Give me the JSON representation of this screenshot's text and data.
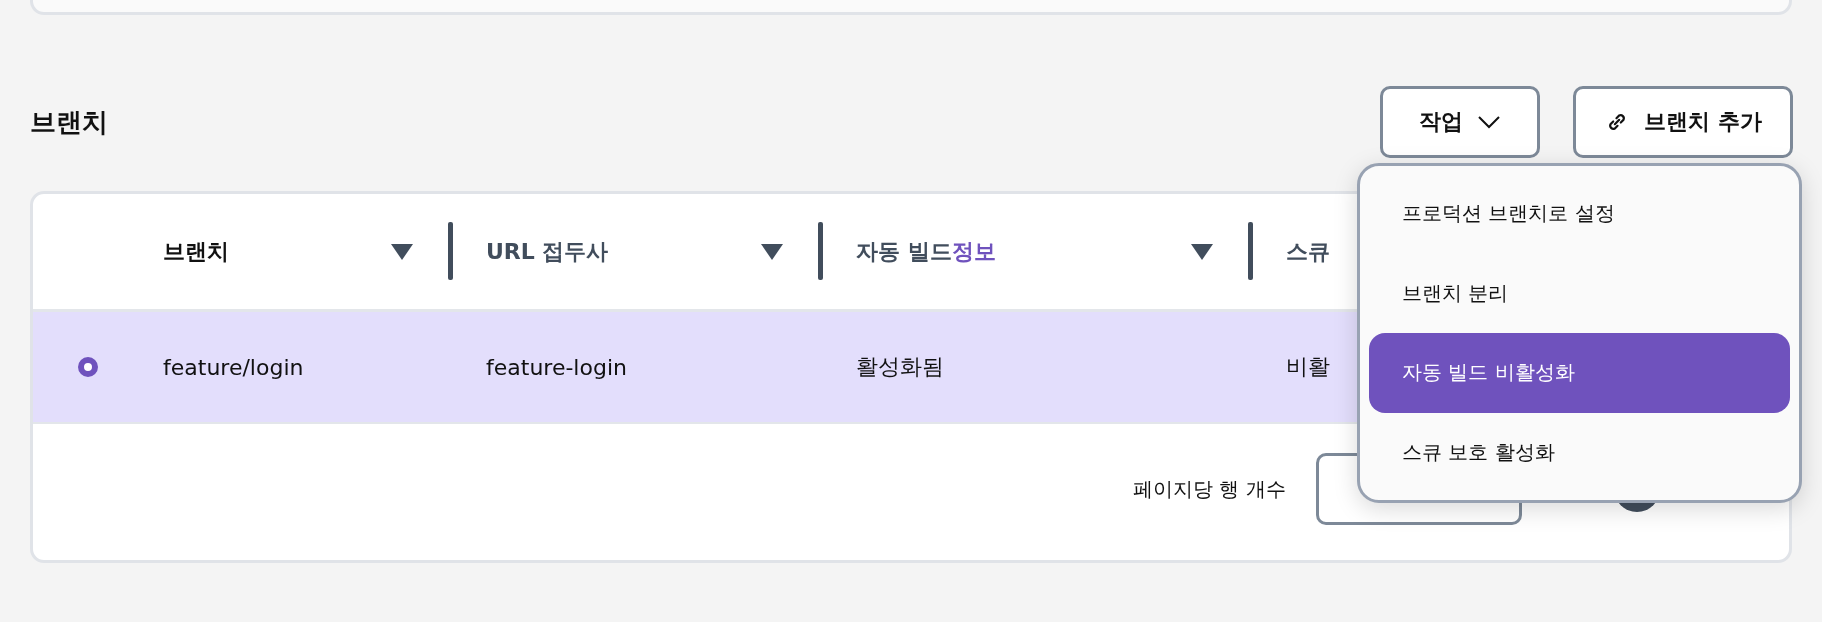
{
  "section": {
    "title": "브랜치"
  },
  "actions": {
    "label": "작업",
    "expanded": true
  },
  "add_button": {
    "label": "브랜치 추가"
  },
  "table": {
    "columns": [
      {
        "label": "브랜치",
        "bold": true
      },
      {
        "label": "URL 접두사"
      },
      {
        "label": "자동 빌드",
        "link": "정보"
      },
      {
        "label": "스큐"
      }
    ],
    "rows": [
      {
        "selected": true,
        "cells": [
          "feature/login",
          "feature-login",
          "활성화됨",
          "비활"
        ]
      }
    ]
  },
  "pagination": {
    "rows_per_page_label": "페이지당 행 개수"
  },
  "menu": {
    "items": [
      {
        "label": "프로덕션 브랜치로 설정",
        "selected": false
      },
      {
        "label": "브랜치 분리",
        "selected": false
      },
      {
        "label": "자동 빌드 비활성화",
        "selected": true
      },
      {
        "label": "스큐 보호 활성화",
        "selected": false
      }
    ]
  }
}
